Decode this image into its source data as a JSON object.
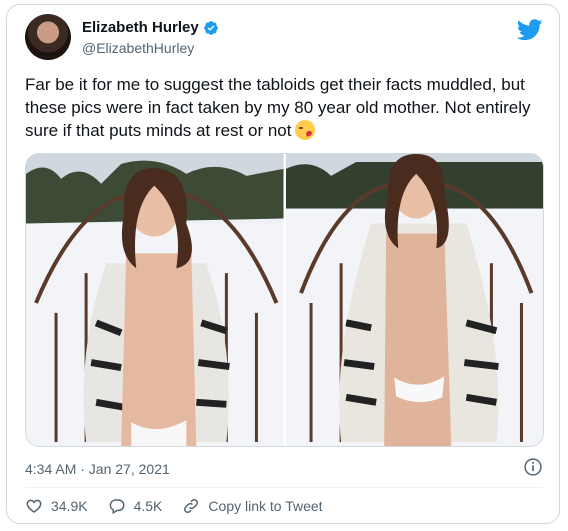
{
  "author": {
    "display_name": "Elizabeth Hurley",
    "handle": "@ElizabethHurley",
    "verified": true
  },
  "tweet": {
    "text": "Far be it for me to suggest the tabloids get their facts muddled, but these pics were in fact taken by my 80 year old mother. Not entirely sure if that puts minds at rest or not",
    "emoji": "winking-kiss-face",
    "timestamp": "4:34 AM · Jan 27, 2021"
  },
  "media": {
    "photo_count": 2
  },
  "actions": {
    "likes": "34.9K",
    "replies": "4.5K",
    "copy_link_label": "Copy link to Tweet"
  },
  "colors": {
    "brand": "#1d9bf0",
    "text_secondary": "#536471",
    "border": "#cfd9de",
    "like_red": "#f91880"
  },
  "icons": [
    "twitter-bird-icon",
    "verified-badge-icon",
    "info-icon",
    "heart-icon",
    "reply-icon",
    "link-icon"
  ]
}
